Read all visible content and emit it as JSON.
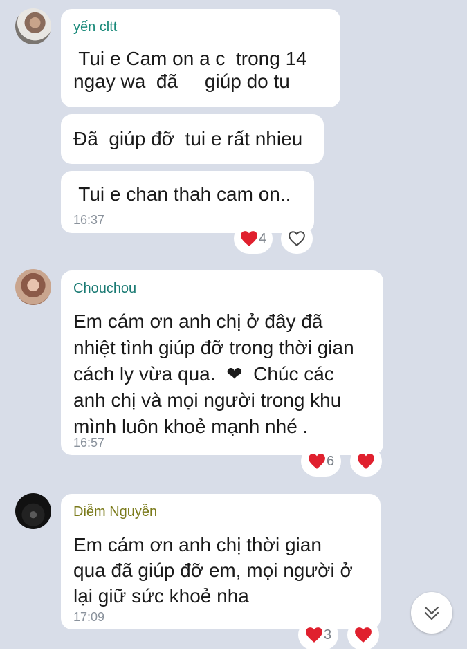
{
  "colors": {
    "background": "#d8dde8",
    "bubble": "#ffffff",
    "heart": "#e0202e",
    "name_user1": "#1a8a7a",
    "name_user2": "#1a7a73",
    "name_user3": "#7a7a1a"
  },
  "messages": [
    {
      "sender": "yến cltt",
      "avatar_icon": "avatar-photo",
      "bubbles": [
        " Tui e Cam on a c  trong 14\nngay wa  đã     giúp do tu",
        "Đã  giúp đỡ  tui e rất nhieu",
        " Tui e chan thah cam on.."
      ],
      "time": "16:37",
      "reaction_count": "4",
      "like_icon": "heart-outline-icon"
    },
    {
      "sender": "Chouchou",
      "avatar_icon": "avatar-photo",
      "text": "Em cám ơn anh chị ở đây đã\nnhiệt tình giúp đỡ trong thời gian\ncách ly vừa qua.  ❤  Chúc các\nanh chị và mọi người trong khu\nmình luôn khoẻ mạnh nhé .",
      "time": "16:57",
      "reaction_count": "6",
      "like_icon": "heart-filled-icon"
    },
    {
      "sender": "Diễm Nguyễn",
      "avatar_icon": "avatar-photo",
      "text": "Em cám ơn anh chị thời gian\nqua đã giúp đỡ em, mọi người ở\nlại giữ sức khoẻ nha",
      "time": "17:09",
      "reaction_count": "3",
      "like_icon": "heart-filled-icon"
    }
  ],
  "scroll_button_icon": "double-chevron-down-icon"
}
